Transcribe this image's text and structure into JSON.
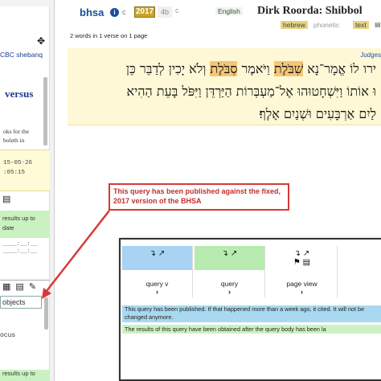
{
  "sidebar": {
    "expand_icon": "expand-arrows-icon",
    "query_name": "CBC shebanq",
    "title": "versus",
    "description": "oks for the\nboleth in",
    "dates": [
      "15-05-26",
      ":05:15"
    ],
    "status_1": [
      "results up to",
      "date"
    ],
    "dashes": "____:__:__\n____:__:__",
    "objects_label": "objects",
    "focus_label": "ocus",
    "status_2": [
      "results up to"
    ]
  },
  "header": {
    "corpus": "bhsa",
    "c_tag": "c",
    "versions": [
      "2017",
      "4b",
      "c"
    ],
    "active_version": "2017",
    "lang_english": "English",
    "title": "Dirk Roorda: Shibbol",
    "lang_hebrew": "hebrew",
    "phonetic": "phonetic",
    "text_button": "text",
    "summary": "2 words in 1 verse on 1 page"
  },
  "verse": {
    "book_label": "Judges",
    "line_1": {
      "before": "ירו לוֹ אֱמָר־נָא ",
      "hl_1": "שִׁבֹּלֶת",
      "mid": " וַיֹּאמֶר ",
      "hl_2": "סִבֹּלֶת",
      "after": " וְלֹא יָכִין לְדַבֵּר כֵּן"
    },
    "line_2": "וּ אוֹתוֹ וַיִּשְׁחָטוּהוּ אֶל־מַעְבְּרוֹת הַיַּרְדֵּן וַיִּפֹּל בָּעֵת הַהִיא",
    "line_3": "לַיִם אַרְבָּעִים וּשְׁנַיִם אָלֶף׃"
  },
  "annotation": {
    "text": "This query has been published against the fixed, 2017 version of the BHSA"
  },
  "inset": {
    "columns": [
      {
        "label": "query v",
        "band_color": "#a8d3f2"
      },
      {
        "label": "query",
        "band_color": "#b8ebb0"
      },
      {
        "label": "page view",
        "band_color": "#ffffff"
      }
    ],
    "message_1": "This query has been published. If that happened more than a week ago, it cited. It will not be changed anymore.",
    "message_2": "The results of this query have been obtained after the query body has been la"
  },
  "colors": {
    "accent_blue": "#1a4f9c",
    "version_gold": "#c8a32d",
    "verse_bg": "#fff8d7",
    "highlight": "#f5c677",
    "annotation_red": "#d93838",
    "status_green": "#c9f2c0"
  }
}
